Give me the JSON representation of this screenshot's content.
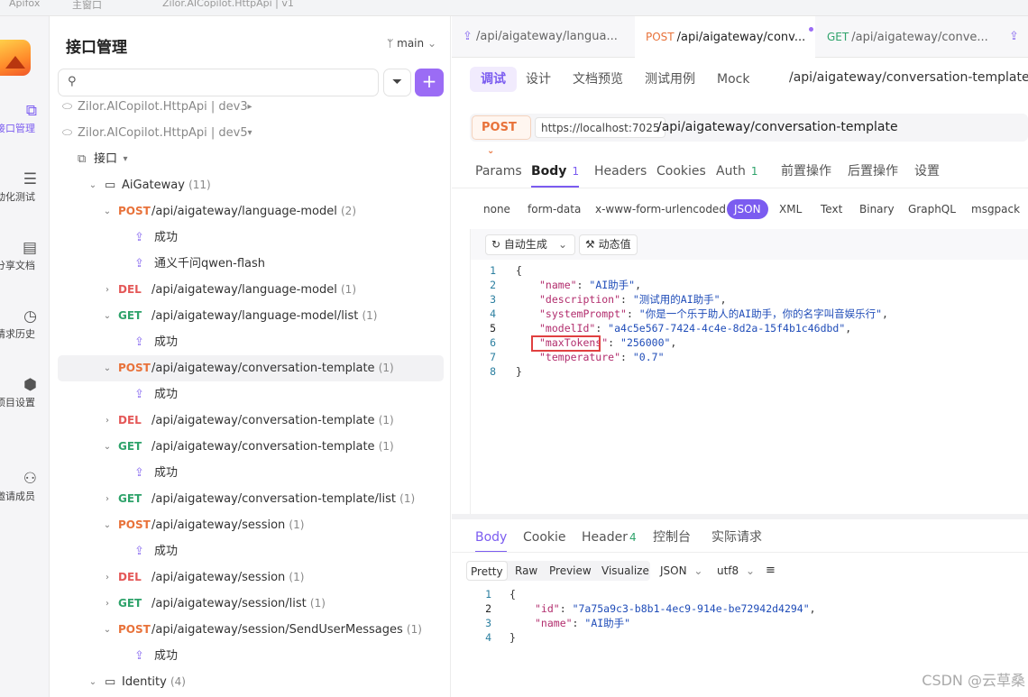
{
  "topbar": {
    "app_name": "Apifox",
    "home_tab": "主窗口",
    "project_tab": "Zilor.AICopilot.HttpApi | v1"
  },
  "rail": {
    "items": [
      {
        "label": "接口管理",
        "icon": "api-icon"
      },
      {
        "label": "自动化测试",
        "icon": "test-icon"
      },
      {
        "label": "分享文档",
        "icon": "book-icon"
      },
      {
        "label": "请求历史",
        "icon": "clock-icon"
      },
      {
        "label": "项目设置",
        "icon": "gear-icon"
      },
      {
        "label": "邀请成员",
        "icon": "add-user-icon"
      }
    ]
  },
  "sidebar": {
    "title": "接口管理",
    "branch": "main",
    "tree": [
      {
        "type": "folder",
        "label": "Zilor.AICopilot.HttpApi | dev3",
        "arrow": "▸"
      },
      {
        "type": "folder",
        "label": "Zilor.AICopilot.HttpApi | dev5",
        "arrow": "▾"
      },
      {
        "type": "group",
        "label": "接口",
        "arrow": "▾"
      },
      {
        "type": "dir",
        "label": "AiGateway",
        "count": "(11)"
      },
      {
        "type": "api",
        "method": "POST",
        "path": "/api/aigateway/language-model",
        "count": "(2)",
        "expanded": true
      },
      {
        "type": "example",
        "label": "成功"
      },
      {
        "type": "example",
        "label": "通义千问qwen-flash"
      },
      {
        "type": "api",
        "method": "DEL",
        "path": "/api/aigateway/language-model",
        "count": "(1)",
        "expanded": false
      },
      {
        "type": "api",
        "method": "GET",
        "path": "/api/aigateway/language-model/list",
        "count": "(1)",
        "expanded": true
      },
      {
        "type": "example",
        "label": "成功"
      },
      {
        "type": "api",
        "method": "POST",
        "path": "/api/aigateway/conversation-template",
        "count": "(1)",
        "expanded": true,
        "selected": true
      },
      {
        "type": "example",
        "label": "成功"
      },
      {
        "type": "api",
        "method": "DEL",
        "path": "/api/aigateway/conversation-template",
        "count": "(1)",
        "expanded": false
      },
      {
        "type": "api",
        "method": "GET",
        "path": "/api/aigateway/conversation-template",
        "count": "(1)",
        "expanded": true
      },
      {
        "type": "example",
        "label": "成功"
      },
      {
        "type": "api",
        "method": "GET",
        "path": "/api/aigateway/conversation-template/list",
        "count": "(1)",
        "expanded": false
      },
      {
        "type": "api",
        "method": "POST",
        "path": "/api/aigateway/session",
        "count": "(1)",
        "expanded": true
      },
      {
        "type": "example",
        "label": "成功"
      },
      {
        "type": "api",
        "method": "DEL",
        "path": "/api/aigateway/session",
        "count": "(1)",
        "expanded": false
      },
      {
        "type": "api",
        "method": "GET",
        "path": "/api/aigateway/session/list",
        "count": "(1)",
        "expanded": false
      },
      {
        "type": "api",
        "method": "POST",
        "path": "/api/aigateway/session/SendUserMessages",
        "count": "(1)",
        "expanded": true
      },
      {
        "type": "example",
        "label": "成功"
      },
      {
        "type": "dir",
        "label": "Identity",
        "count": "(4)"
      }
    ]
  },
  "tabs": [
    {
      "method": "",
      "label": "/api/aigateway/langua..."
    },
    {
      "method": "POST",
      "label": "/api/aigateway/conv..."
    },
    {
      "method": "GET",
      "label": "/api/aigateway/conve..."
    }
  ],
  "subtabs": [
    "调试",
    "设计",
    "文档预览",
    "测试用例",
    "Mock"
  ],
  "subpath": "/api/aigateway/conversation-template",
  "request": {
    "method": "POST",
    "host": "https://localhost:7025",
    "path": "/api/aigateway/conversation-template",
    "tabs": [
      {
        "label": "Params",
        "badge": ""
      },
      {
        "label": "Body",
        "badge": "1"
      },
      {
        "label": "Headers",
        "badge": ""
      },
      {
        "label": "Cookies",
        "badge": ""
      },
      {
        "label": "Auth",
        "badge": "1"
      },
      {
        "label": "前置操作",
        "badge": ""
      },
      {
        "label": "后置操作",
        "badge": ""
      },
      {
        "label": "设置",
        "badge": ""
      }
    ],
    "body_types": [
      "none",
      "form-data",
      "x-www-form-urlencoded",
      "JSON",
      "XML",
      "Text",
      "Binary",
      "GraphQL",
      "msgpack"
    ],
    "auto_generate": "自动生成",
    "dynamic_value": "动态值",
    "code": [
      {
        "n": "1",
        "text": "{"
      },
      {
        "n": "2",
        "key": "\"name\"",
        "val": "\"AI助手\""
      },
      {
        "n": "3",
        "key": "\"description\"",
        "val": "\"测试用的AI助手\""
      },
      {
        "n": "4",
        "key": "\"systemPrompt\"",
        "val": "\"你是一个乐于助人的AI助手，你的名字叫音娱乐行\""
      },
      {
        "n": "5",
        "key": "\"modelId\"",
        "val": "\"a4c5e567-7424-4c4e-8d2a-15f4b1c46dbd\""
      },
      {
        "n": "6",
        "key": "\"maxTokens\"",
        "val": "\"256000\""
      },
      {
        "n": "7",
        "key": "\"temperature\"",
        "val": "\"0.7\""
      },
      {
        "n": "8",
        "text": "}"
      }
    ]
  },
  "response": {
    "tabs": [
      {
        "label": "Body",
        "badge": ""
      },
      {
        "label": "Cookie",
        "badge": ""
      },
      {
        "label": "Header",
        "badge": "4"
      },
      {
        "label": "控制台",
        "badge": ""
      },
      {
        "label": "实际请求",
        "badge": ""
      }
    ],
    "views": [
      "Pretty",
      "Raw",
      "Preview",
      "Visualize"
    ],
    "format": "JSON",
    "encoding": "utf8",
    "code": [
      {
        "n": "1",
        "text": "{"
      },
      {
        "n": "2",
        "key": "\"id\"",
        "val": "\"7a75a9c3-b8b1-4ec9-914e-be72942d4294\""
      },
      {
        "n": "3",
        "key": "\"name\"",
        "val": "\"AI助手\""
      },
      {
        "n": "4",
        "text": "}"
      }
    ]
  },
  "watermark": "CSDN @云草桑"
}
